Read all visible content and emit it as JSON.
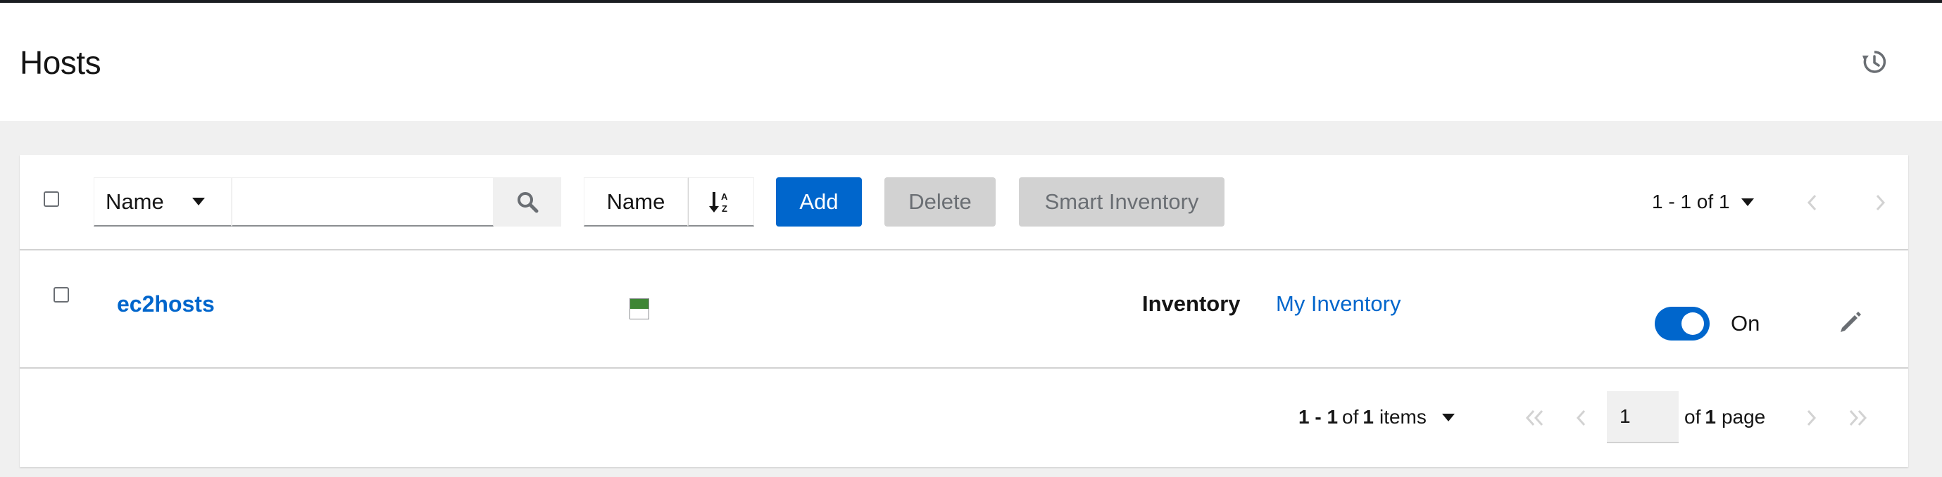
{
  "header": {
    "title": "Hosts",
    "history_icon": "history-icon"
  },
  "toolbar": {
    "search_field": "Name",
    "search_value": "",
    "sort_field": "Name",
    "sort_icon": "sort-alpha-down-icon",
    "add_label": "Add",
    "delete_label": "Delete",
    "smart_inventory_label": "Smart Inventory",
    "pagination_text": "1 - 1 of 1"
  },
  "hosts": [
    {
      "name": "ec2hosts",
      "status": "ok",
      "inventory_label": "Inventory",
      "inventory_name": "My Inventory",
      "enabled": true,
      "toggle_label": "On"
    }
  ],
  "footer": {
    "range": "1 - 1",
    "of_label": "of",
    "total": "1",
    "items_label": "items",
    "current_page": "1",
    "of_pages_label": "of",
    "page_count": "1",
    "page_label": "page"
  },
  "colors": {
    "primary": "#0066cc",
    "success": "#3e8635",
    "disabled": "#d2d2d2"
  }
}
